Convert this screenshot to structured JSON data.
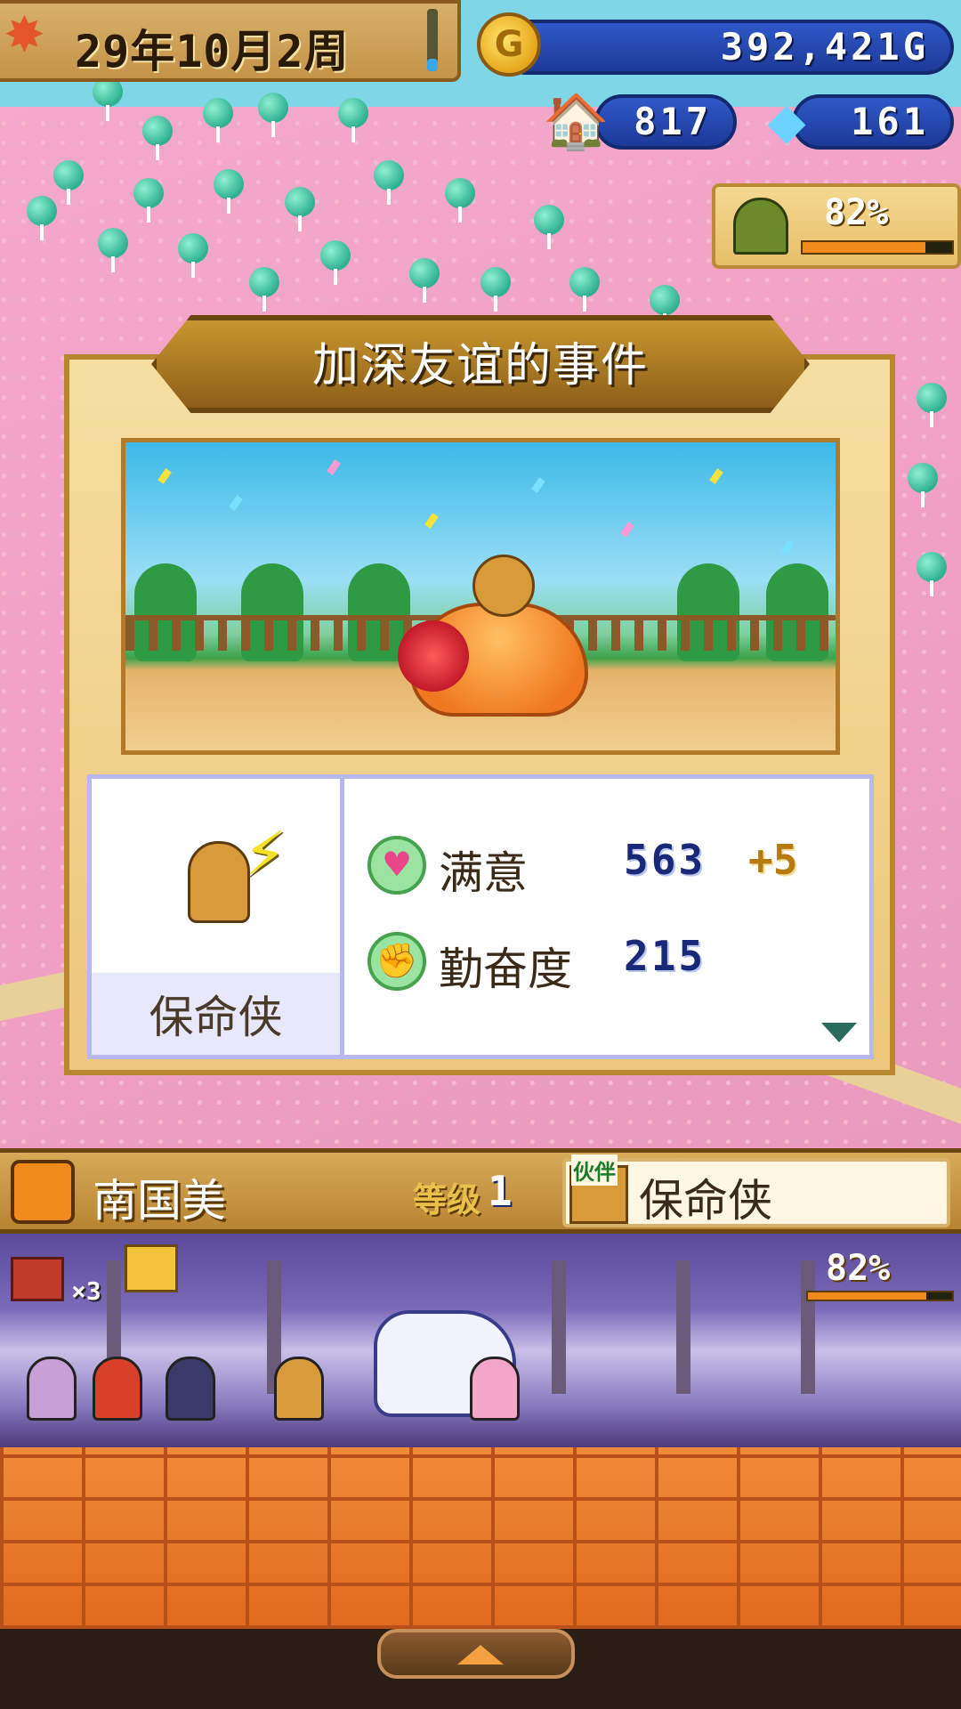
{
  "hud": {
    "date_text": "29年10月2周",
    "gold": "392,421G",
    "gold_icon_letter": "G",
    "population": "817",
    "crystals": "161",
    "hut_progress_text": "82%",
    "hut_progress_value": 0.82
  },
  "dialog": {
    "title": "加深友谊的事件",
    "character_name": "保命侠",
    "stats": [
      {
        "label": "满意",
        "value": "563",
        "delta": "+5",
        "icon": "heart-icon"
      },
      {
        "label": "勤奋度",
        "value": "215",
        "delta": "",
        "icon": "fist-icon"
      }
    ]
  },
  "companion_bar": {
    "hero_name": "南国美",
    "level_label": "等级",
    "level_value": "1",
    "partner_tag": "伙伴",
    "partner_name": "保命侠"
  },
  "party": {
    "chest_count": "×3",
    "progress_text": "82%",
    "progress_value": 0.82
  },
  "colors": {
    "accent_gold": "#c8962f",
    "pill_blue": "#2f58c8",
    "progress_orange": "#f08a1a"
  }
}
